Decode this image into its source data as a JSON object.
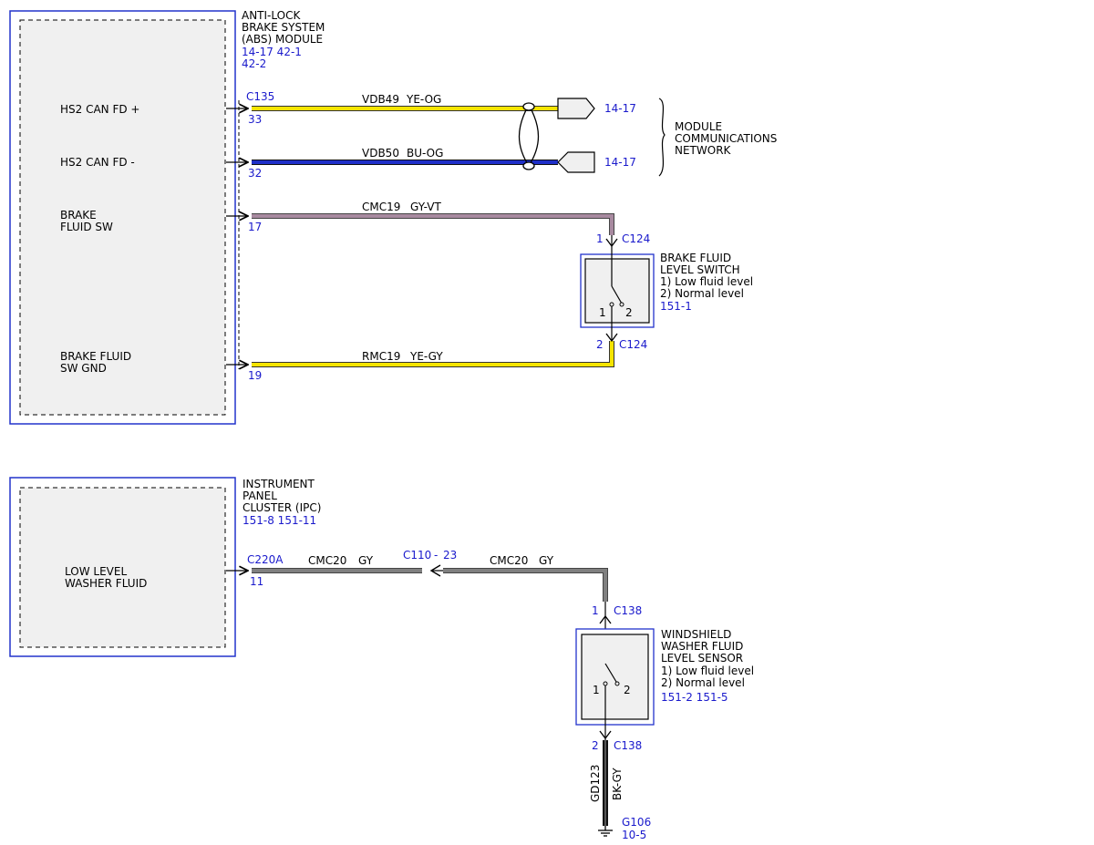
{
  "abs_module": {
    "name": [
      "ANTI-LOCK",
      "BRAKE SYSTEM",
      "(ABS) MODULE"
    ],
    "refs": [
      "14-17  42-1",
      "42-2"
    ],
    "pins": [
      {
        "label": [
          "HS2 CAN FD +"
        ],
        "pin": "33"
      },
      {
        "label": [
          "HS2 CAN FD -"
        ],
        "pin": "32"
      },
      {
        "label": [
          "BRAKE",
          "FLUID SW"
        ],
        "pin": "17"
      },
      {
        "label": [
          "BRAKE FLUID",
          "SW GND"
        ],
        "pin": "19"
      }
    ],
    "connector": "C135"
  },
  "wires_abs": [
    {
      "circuit": "VDB49",
      "color_code": "YE-OG",
      "stroke": "#f5e400"
    },
    {
      "circuit": "VDB50",
      "color_code": "BU-OG",
      "stroke": "#1e2fc8"
    },
    {
      "circuit": "CMC19",
      "color_code": "GY-VT",
      "stroke": "#a88aa0"
    },
    {
      "circuit": "RMC19",
      "color_code": "YE-GY",
      "stroke": "#f5e400"
    }
  ],
  "network": {
    "refs": [
      "14-17",
      "14-17"
    ],
    "label": [
      "MODULE",
      "COMMUNICATIONS",
      "NETWORK"
    ]
  },
  "brake_switch": {
    "top_pin": "1",
    "top_connector": "C124",
    "bottom_pin": "2",
    "bottom_connector": "C124",
    "name": [
      "BRAKE FLUID",
      "LEVEL SWITCH",
      "1) Low fluid level",
      "2) Normal level"
    ],
    "ref": "151-1",
    "contact_labels": [
      "1",
      "2"
    ]
  },
  "ipc": {
    "name": [
      "INSTRUMENT",
      "PANEL",
      "CLUSTER (IPC)"
    ],
    "refs": "151-8    151-11",
    "pin_label": [
      "LOW LEVEL",
      "WASHER FLUID"
    ],
    "connector": "C220A",
    "pin": "11"
  },
  "washer_wires": [
    {
      "circuit": "CMC20",
      "color_code": "GY"
    },
    {
      "circuit": "CMC20",
      "color_code": "GY"
    }
  ],
  "inline_connector": {
    "name": "C110",
    "sep": "-",
    "pin": "23"
  },
  "washer_sensor": {
    "top_pin": "1",
    "top_connector": "C138",
    "bottom_pin": "2",
    "bottom_connector": "C138",
    "name": [
      "WINDSHIELD",
      "WASHER FLUID",
      "LEVEL SENSOR",
      "1) Low fluid level",
      "2) Normal level"
    ],
    "refs": "151-2   151-5",
    "contact_labels": [
      "1",
      "2"
    ]
  },
  "ground_wire": {
    "circuit": "GD123",
    "color_code": "BK-GY"
  },
  "ground": {
    "name": "G106",
    "ref": "10-5"
  },
  "colors": {
    "module_border": "#2233cc",
    "ref_blue": "#1a1acc",
    "gray_wire": "#808080",
    "black_wire": "#111111"
  }
}
